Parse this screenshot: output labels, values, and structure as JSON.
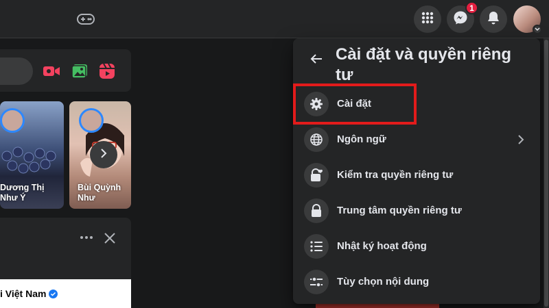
{
  "topbar": {
    "icons": [
      "gamepad-icon",
      "menu-grid-icon",
      "messenger-icon",
      "bell-icon"
    ],
    "messenger_badge": "1"
  },
  "composer": {
    "icons": [
      "live-video-icon",
      "photo-icon",
      "reels-icon"
    ]
  },
  "stories": [
    {
      "name": "Dương Thị Như Ý"
    },
    {
      "name": "Bùi Quỳnh Như"
    }
  ],
  "post": {
    "page_name": "i Việt Nam"
  },
  "menu": {
    "title": "Cài đặt và quyền riêng tư",
    "items": [
      {
        "label": "Cài đặt",
        "icon": "gear-icon"
      },
      {
        "label": "Ngôn ngữ",
        "icon": "globe-icon"
      },
      {
        "label": "Kiểm tra quyền riêng tư",
        "icon": "lock-heart-icon"
      },
      {
        "label": "Trung tâm quyền riêng tư",
        "icon": "lock-icon"
      },
      {
        "label": "Nhật ký hoạt động",
        "icon": "list-icon"
      },
      {
        "label": "Tùy chọn nội dung",
        "icon": "sliders-icon"
      }
    ]
  },
  "colors": {
    "background": "#18191a",
    "surface": "#242526",
    "highlight": "#e21b1b",
    "badge": "#e41e3f"
  }
}
